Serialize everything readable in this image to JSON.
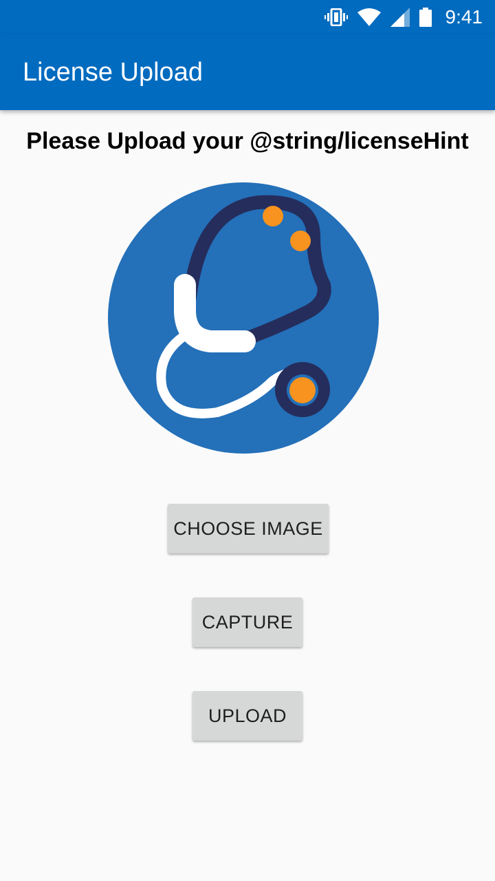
{
  "status_bar": {
    "time": "9:41",
    "icons": [
      "vibrate-icon",
      "wifi-icon",
      "signal-icon",
      "battery-icon"
    ]
  },
  "app_bar": {
    "title": "License Upload"
  },
  "main": {
    "hint_text": "Please Upload your @string/licenseHint",
    "logo": "stethoscope-logo",
    "buttons": {
      "choose_image": "CHOOSE IMAGE",
      "capture": "CAPTURE",
      "upload": "UPLOAD"
    }
  },
  "colors": {
    "primary": "#016bbf",
    "logo_circle": "#2470b9",
    "logo_dark": "#252d5c",
    "logo_orange": "#f7931e",
    "button_bg": "#d6d7d7",
    "background": "#fafafa"
  }
}
